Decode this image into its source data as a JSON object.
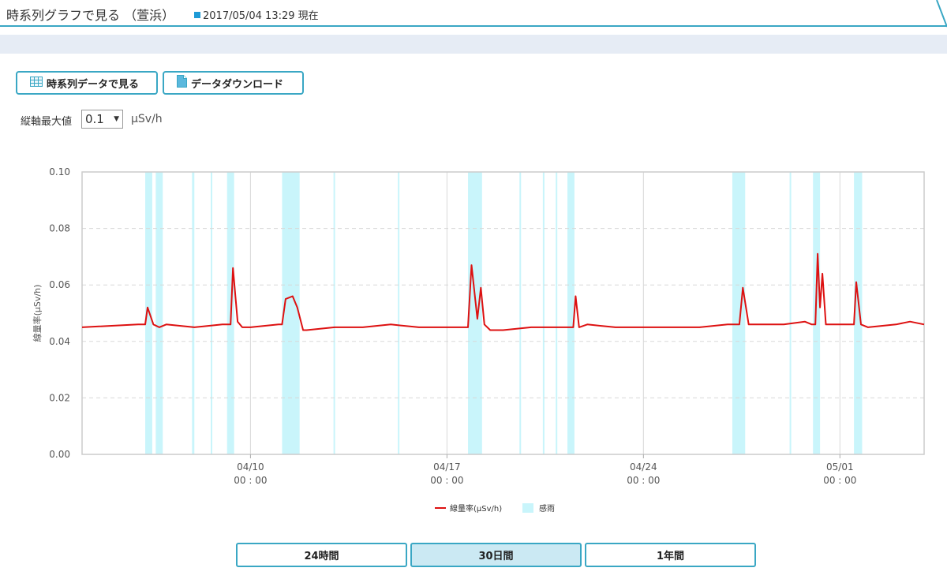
{
  "header": {
    "title": "時系列グラフで見る （萱浜）",
    "timestamp": "2017/05/04 13:29 現在"
  },
  "toolbar": {
    "timeseries_button": "時系列データで見る",
    "download_button": "データダウンロード"
  },
  "yaxis_control": {
    "label": "縦軸最大値",
    "selected": "0.1",
    "unit": "µSv/h"
  },
  "chart_data": {
    "type": "line",
    "ylabel": "線量率(µSv/h)",
    "ylim": [
      0,
      0.1
    ],
    "y_ticks": [
      "0.00",
      "0.02",
      "0.04",
      "0.06",
      "0.08",
      "0.10"
    ],
    "x_range_days": [
      "2017-04-04",
      "2017-05-04"
    ],
    "x_ticks": [
      {
        "date": "2017-04-10",
        "line1": "04/10",
        "line2": "00 : 00"
      },
      {
        "date": "2017-04-17",
        "line1": "04/17",
        "line2": "00 : 00"
      },
      {
        "date": "2017-04-24",
        "line1": "04/24",
        "line2": "00 : 00"
      },
      {
        "date": "2017-05-01",
        "line1": "05/01",
        "line2": "00 : 00"
      }
    ],
    "grid": true,
    "legend_position": "bottom-center",
    "colors": {
      "dose": "#dd1111",
      "rain": "#c9f5fb"
    },
    "series": [
      {
        "name": "線量率(µSv/h)",
        "points": [
          [
            "2017-04-04",
            0.045
          ],
          [
            "2017-04-06",
            0.046
          ],
          [
            "2017-04-06 06:00",
            0.046
          ],
          [
            "2017-04-06 08:00",
            0.052
          ],
          [
            "2017-04-06 13:00",
            0.046
          ],
          [
            "2017-04-06 18:00",
            0.045
          ],
          [
            "2017-04-07",
            0.046
          ],
          [
            "2017-04-08",
            0.045
          ],
          [
            "2017-04-09",
            0.046
          ],
          [
            "2017-04-09 07:00",
            0.046
          ],
          [
            "2017-04-09 09:00",
            0.066
          ],
          [
            "2017-04-09 13:00",
            0.047
          ],
          [
            "2017-04-09 17:00",
            0.045
          ],
          [
            "2017-04-10",
            0.045
          ],
          [
            "2017-04-11",
            0.046
          ],
          [
            "2017-04-11 03:00",
            0.046
          ],
          [
            "2017-04-11 06:00",
            0.055
          ],
          [
            "2017-04-11 12:00",
            0.056
          ],
          [
            "2017-04-11 16:00",
            0.052
          ],
          [
            "2017-04-11 21:00",
            0.044
          ],
          [
            "2017-04-12",
            0.044
          ],
          [
            "2017-04-13",
            0.045
          ],
          [
            "2017-04-14",
            0.045
          ],
          [
            "2017-04-15",
            0.046
          ],
          [
            "2017-04-16",
            0.045
          ],
          [
            "2017-04-17",
            0.045
          ],
          [
            "2017-04-17 18:00",
            0.045
          ],
          [
            "2017-04-17 21:00",
            0.067
          ],
          [
            "2017-04-18 02:00",
            0.048
          ],
          [
            "2017-04-18 05:00",
            0.059
          ],
          [
            "2017-04-18 08:00",
            0.046
          ],
          [
            "2017-04-18 13:00",
            0.044
          ],
          [
            "2017-04-19",
            0.044
          ],
          [
            "2017-04-20",
            0.045
          ],
          [
            "2017-04-21",
            0.045
          ],
          [
            "2017-04-21 12:00",
            0.045
          ],
          [
            "2017-04-21 14:00",
            0.056
          ],
          [
            "2017-04-21 17:00",
            0.045
          ],
          [
            "2017-04-22",
            0.046
          ],
          [
            "2017-04-23",
            0.045
          ],
          [
            "2017-04-24",
            0.045
          ],
          [
            "2017-04-25",
            0.045
          ],
          [
            "2017-04-26",
            0.045
          ],
          [
            "2017-04-27",
            0.046
          ],
          [
            "2017-04-27 10:00",
            0.046
          ],
          [
            "2017-04-27 13:00",
            0.059
          ],
          [
            "2017-04-27 18:00",
            0.046
          ],
          [
            "2017-04-28",
            0.046
          ],
          [
            "2017-04-29",
            0.046
          ],
          [
            "2017-04-29 18:00",
            0.047
          ],
          [
            "2017-04-30",
            0.046
          ],
          [
            "2017-04-30 03:00",
            0.046
          ],
          [
            "2017-04-30 05:00",
            0.071
          ],
          [
            "2017-04-30 07:00",
            0.052
          ],
          [
            "2017-04-30 09:00",
            0.064
          ],
          [
            "2017-04-30 12:00",
            0.046
          ],
          [
            "2017-05-01",
            0.046
          ],
          [
            "2017-05-01 12:00",
            0.046
          ],
          [
            "2017-05-01 14:00",
            0.061
          ],
          [
            "2017-05-01 18:00",
            0.046
          ],
          [
            "2017-05-02",
            0.045
          ],
          [
            "2017-05-03",
            0.046
          ],
          [
            "2017-05-03 12:00",
            0.047
          ],
          [
            "2017-05-04",
            0.046
          ]
        ]
      },
      {
        "name": "感雨",
        "spans": [
          [
            "2017-04-06 06:00",
            "2017-04-06 12:00"
          ],
          [
            "2017-04-06 15:00",
            "2017-04-06 21:00"
          ],
          [
            "2017-04-07 22:00",
            "2017-04-08 00:00"
          ],
          [
            "2017-04-08 14:00",
            "2017-04-08 15:00"
          ],
          [
            "2017-04-09 04:00",
            "2017-04-09 10:00"
          ],
          [
            "2017-04-11 03:00",
            "2017-04-11 18:00"
          ],
          [
            "2017-04-12 23:00",
            "2017-04-13 00:00"
          ],
          [
            "2017-04-15 06:00",
            "2017-04-15 07:00"
          ],
          [
            "2017-04-17 18:00",
            "2017-04-18 06:00"
          ],
          [
            "2017-04-19 14:00",
            "2017-04-19 15:00"
          ],
          [
            "2017-04-20 10:00",
            "2017-04-20 11:00"
          ],
          [
            "2017-04-20 21:00",
            "2017-04-20 22:00"
          ],
          [
            "2017-04-21 07:00",
            "2017-04-21 13:00"
          ],
          [
            "2017-04-27 04:00",
            "2017-04-27 15:00"
          ],
          [
            "2017-04-29 05:00",
            "2017-04-29 06:00"
          ],
          [
            "2017-04-30 01:00",
            "2017-04-30 07:00"
          ],
          [
            "2017-05-01 12:00",
            "2017-05-01 19:00"
          ]
        ]
      }
    ]
  },
  "period_tabs": [
    {
      "label": "24時間",
      "active": false
    },
    {
      "label": "30日間",
      "active": true
    },
    {
      "label": "1年間",
      "active": false
    }
  ]
}
